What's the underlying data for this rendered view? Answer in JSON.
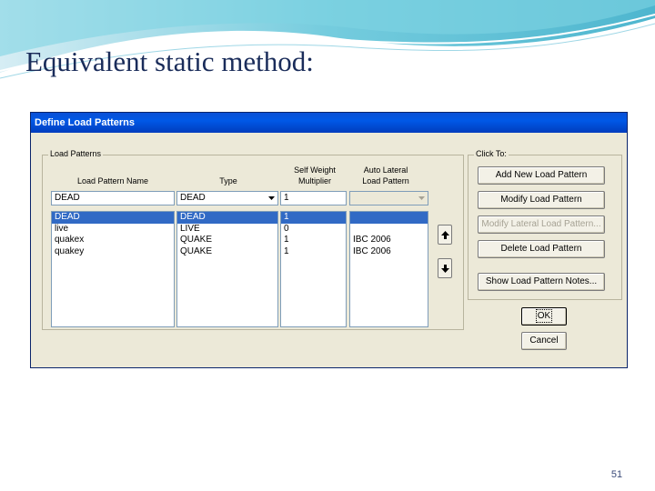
{
  "slide": {
    "title": "Equivalent static method:",
    "page_number": "51"
  },
  "dialog": {
    "title": "Define Load Patterns",
    "load_patterns_group": {
      "label": "Load Patterns",
      "columns": {
        "name": "Load Pattern Name",
        "type": "Type",
        "self_weight_1": "Self Weight",
        "self_weight_2": "Multiplier",
        "auto_lateral_1": "Auto Lateral",
        "auto_lateral_2": "Load Pattern"
      },
      "edit_row": {
        "name": "DEAD",
        "type": "DEAD",
        "multiplier": "1",
        "auto_lateral": ""
      },
      "rows": [
        {
          "name": "DEAD",
          "type": "DEAD",
          "multiplier": "1",
          "auto_lateral": ""
        },
        {
          "name": "live",
          "type": "LIVE",
          "multiplier": "0",
          "auto_lateral": ""
        },
        {
          "name": "quakex",
          "type": "QUAKE",
          "multiplier": "1",
          "auto_lateral": "IBC 2006"
        },
        {
          "name": "quakey",
          "type": "QUAKE",
          "multiplier": "1",
          "auto_lateral": "IBC 2006"
        }
      ],
      "selected_row_index": 0
    },
    "click_to_group": {
      "label": "Click To:",
      "buttons": {
        "add": "Add New Load Pattern",
        "modify": "Modify Load Pattern",
        "modify_lateral": "Modify Lateral Load Pattern...",
        "delete": "Delete Load Pattern",
        "show_notes": "Show Load Pattern Notes..."
      }
    },
    "ok": "OK",
    "cancel": "Cancel"
  }
}
